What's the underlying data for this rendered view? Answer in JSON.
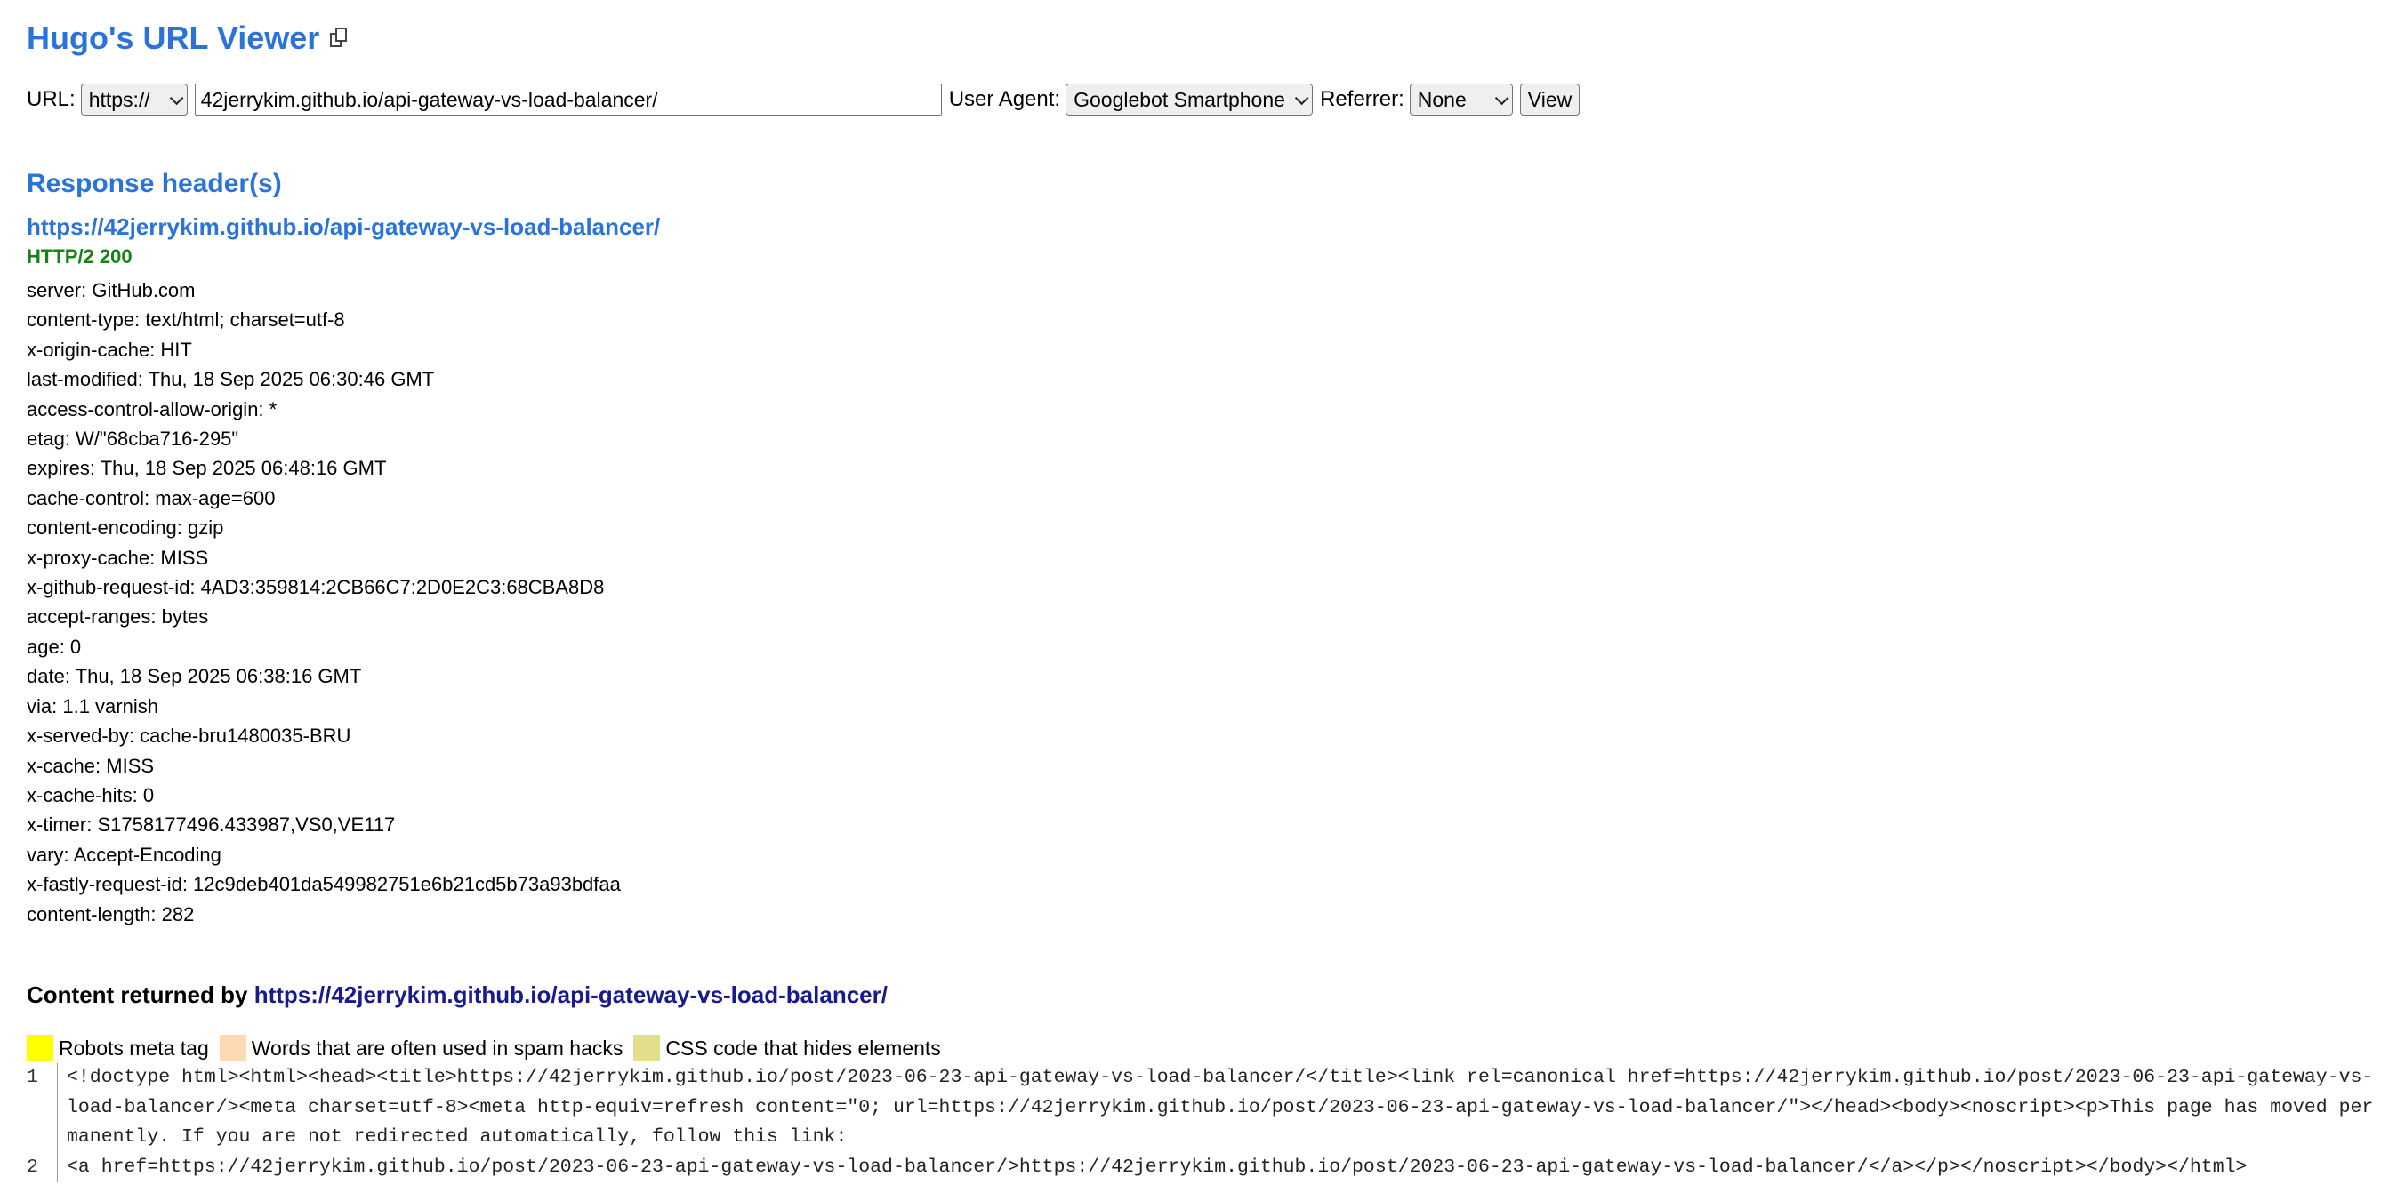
{
  "app": {
    "title": "Hugo's URL Viewer",
    "copy_icon": "copy-icon"
  },
  "form": {
    "url_label": "URL:",
    "protocol": "https://",
    "url_value": "42jerrykim.github.io/api-gateway-vs-load-balancer/",
    "user_agent_label": "User Agent:",
    "user_agent": "Googlebot Smartphone",
    "referrer_label": "Referrer:",
    "referrer": "None",
    "view_label": "View"
  },
  "response": {
    "heading": "Response header(s)",
    "url": "https://42jerrykim.github.io/api-gateway-vs-load-balancer/",
    "status": "HTTP/2 200",
    "headers": [
      "server: GitHub.com",
      "content-type: text/html; charset=utf-8",
      "x-origin-cache: HIT",
      "last-modified: Thu, 18 Sep 2025 06:30:46 GMT",
      "access-control-allow-origin: *",
      "etag: W/\"68cba716-295\"",
      "expires: Thu, 18 Sep 2025 06:48:16 GMT",
      "cache-control: max-age=600",
      "content-encoding: gzip",
      "x-proxy-cache: MISS",
      "x-github-request-id: 4AD3:359814:2CB66C7:2D0E2C3:68CBA8D8",
      "accept-ranges: bytes",
      "age: 0",
      "date: Thu, 18 Sep 2025 06:38:16 GMT",
      "via: 1.1 varnish",
      "x-served-by: cache-bru1480035-BRU",
      "x-cache: MISS",
      "x-cache-hits: 0",
      "x-timer: S1758177496.433987,VS0,VE117",
      "vary: Accept-Encoding",
      "x-fastly-request-id: 12c9deb401da549982751e6b21cd5b73a93bdfaa",
      "content-length: 282"
    ]
  },
  "content": {
    "label": "Content returned by",
    "url": "https://42jerrykim.github.io/api-gateway-vs-load-balancer/",
    "legend": [
      {
        "label": "Robots meta tag",
        "color": "#ffff00"
      },
      {
        "label": "Words that are often used in spam hacks",
        "color": "#ffd9b3"
      },
      {
        "label": "CSS code that hides elements",
        "color": "#e3de8a"
      }
    ],
    "lines": [
      {
        "num": "1",
        "text": "<!doctype html><html><head><title>https://42jerrykim.github.io/post/2023-06-23-api-gateway-vs-load-balancer/</title><link rel=canonical href=https://42jerrykim.github.io/post/2023-06-23-api-gateway-vs-load-balancer/><meta charset=utf-8><meta http-equiv=refresh content=\"0; url=https://42jerrykim.github.io/post/2023-06-23-api-gateway-vs-load-balancer/\"></head><body><noscript><p>This page has moved permanently. If you are not redirected automatically, follow this link:"
      },
      {
        "num": "2",
        "text": "<a href=https://42jerrykim.github.io/post/2023-06-23-api-gateway-vs-load-balancer/>https://42jerrykim.github.io/post/2023-06-23-api-gateway-vs-load-balancer/</a></p></noscript></body></html>"
      }
    ]
  }
}
